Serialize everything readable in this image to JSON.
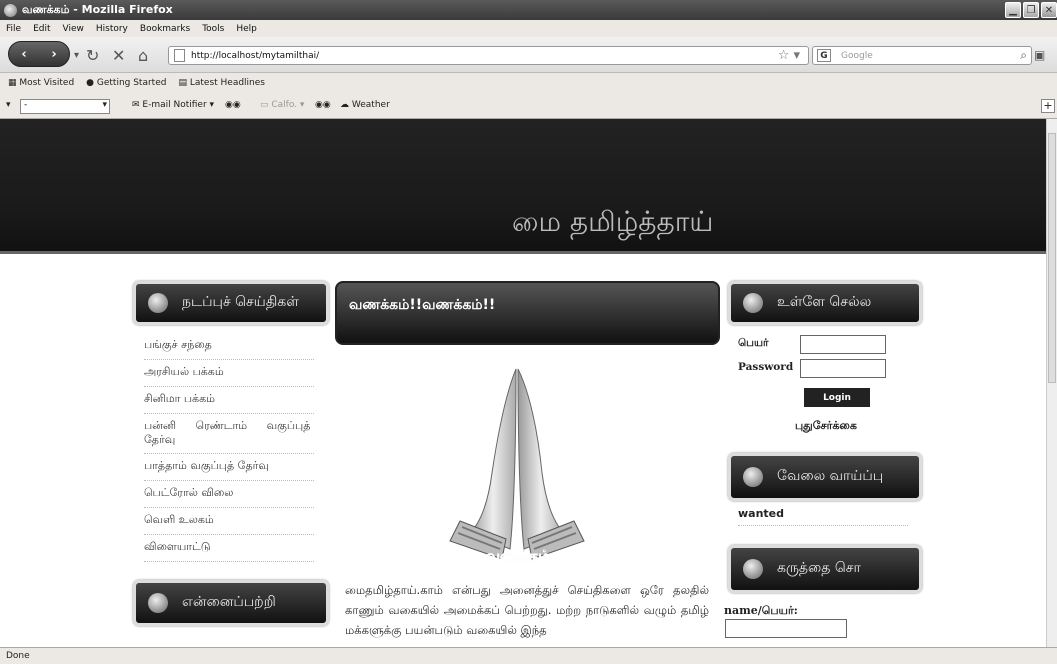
{
  "browser": {
    "title": "வணக்கம் - Mozilla Firefox",
    "menu": [
      "File",
      "Edit",
      "View",
      "History",
      "Bookmarks",
      "Tools",
      "Help"
    ],
    "url": "http://localhost/mytamilthai/",
    "search_placeholder": "Google",
    "bookmarks": [
      "Most Visited",
      "Getting Started",
      "Latest Headlines"
    ],
    "addons": {
      "select_value": "-",
      "email": "E-mail Notifier",
      "radio": "Calfo.",
      "weather": "Weather"
    },
    "status": "Done"
  },
  "page": {
    "site_title": "மை தமிழ்த்தாய்",
    "left_heading": "நடப்புச் செய்திகள்",
    "left_items": [
      "பங்குச் சந்தை",
      "அரசியல் பக்கம்",
      "சினிமா பக்கம்",
      "பன்னி ரெண்டாம் வகுப்புத் தேர்வு",
      "பாத்தாம் வகுப்புத் தேர்வு",
      "பெட்ரோல் விலை",
      "வெளி உலகம்",
      "விளையாட்டு"
    ],
    "left_heading2": "என்னைப்பற்றி",
    "center_heading": "வணக்கம்!!வணக்கம்!!",
    "image_caption": "வணக்கம்",
    "paragraph": "மைதமிழ்தாய்.காம் என்பது அனைத்துச் செய்திகளை ஒரே தலதில் காணும் வகையில் அமைக்கப் பெற்றது. மற்ற நாடுகளில் வழும் தமிழ் மக்களுக்கு பயன்படும் வகையில் இந்த",
    "login_heading": "உள்ளே செல்ல",
    "name_label": "பெயர்",
    "password_label": "Password",
    "login_button": "Login",
    "new_account": "புதுசேர்க்கை",
    "jobs_heading": "வேலை வாய்ப்பு",
    "jobs_item": "wanted",
    "feedback_heading": "கருத்தை சொ",
    "feedback_name_label": "name/பெயர்:"
  }
}
